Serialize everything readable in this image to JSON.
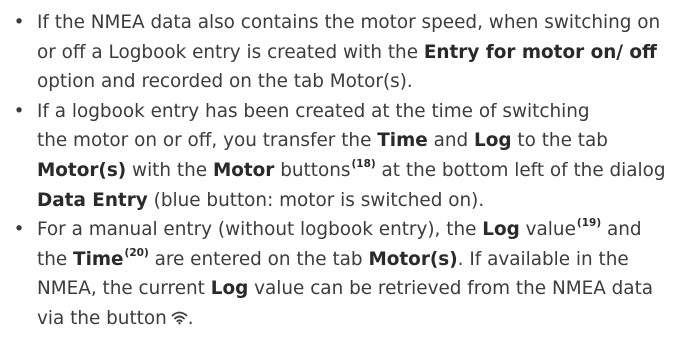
{
  "bullet_symbol": "•",
  "items": [
    {
      "t1": "If the NMEA data also contains the motor speed, when switching on or off a Logbook entry is created with the ",
      "b1": "Entry for motor on/ off",
      "t2": " option and recorded on the tab Motor(s)."
    },
    {
      "l1": "If a logbook entry has been created at the time of switching",
      "t1": "the motor on or off, you transfer the ",
      "b1": "Time",
      "t2": " and ",
      "b2": "Log",
      "t3": " to the tab ",
      "b3": "Motor(s)",
      "t4": " with the ",
      "b4": "Motor",
      "t5": " buttons",
      "ref1": "(18)",
      "t6": " at the bottom left of the dialog ",
      "b5": "Data Entry",
      "t7": " (blue button: motor is switched on)."
    },
    {
      "t1": "For a manual entry (without logbook entry), the ",
      "b1": "Log",
      "t2": " value",
      "ref1": "(19)",
      "t3": " and the ",
      "b2": "Time",
      "ref2": "(20)",
      "t4": " are entered on the tab ",
      "b3": "Motor(s)",
      "t5": ". If available in the NMEA, the current ",
      "b4": "Log",
      "t6": " value can be retrieved from the NMEA data via the button",
      "t7": "."
    }
  ],
  "icons": {
    "nmea_button": "wifi-icon"
  }
}
